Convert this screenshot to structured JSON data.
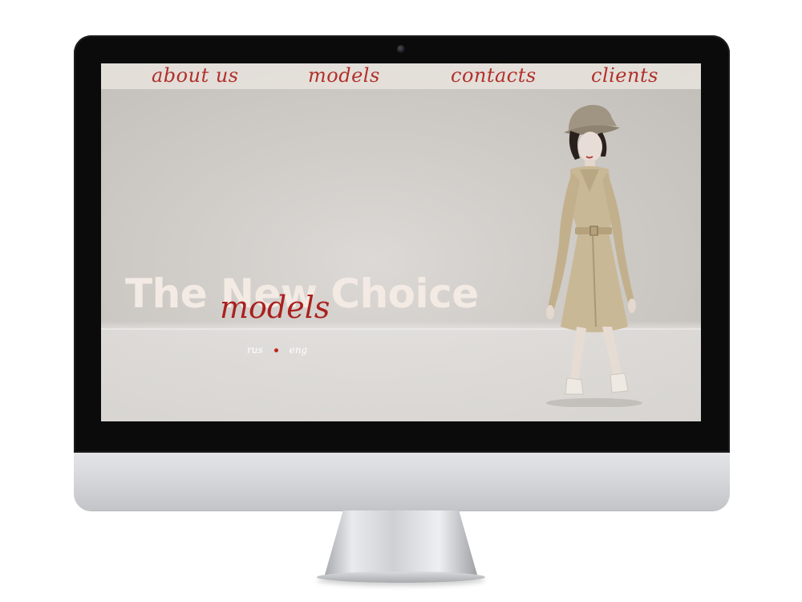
{
  "nav": {
    "about_label": "about  us",
    "models_label": "models",
    "contacts_label": "contacts",
    "clients_label": "clients"
  },
  "hero": {
    "title": "The New Choice",
    "subtitle": "models"
  },
  "language": {
    "rus_label": "rus",
    "eng_label": "eng"
  },
  "colors": {
    "accent": "#b2302b",
    "title_text": "#f5ece6",
    "nav_bar": "#e9e4de",
    "background": "#cfcbc7",
    "bezel": "#0b0b0c",
    "monitor_chin": "#d3d4d7"
  },
  "icons": {
    "camera": "webcam-icon",
    "language_separator": "dot-icon"
  }
}
